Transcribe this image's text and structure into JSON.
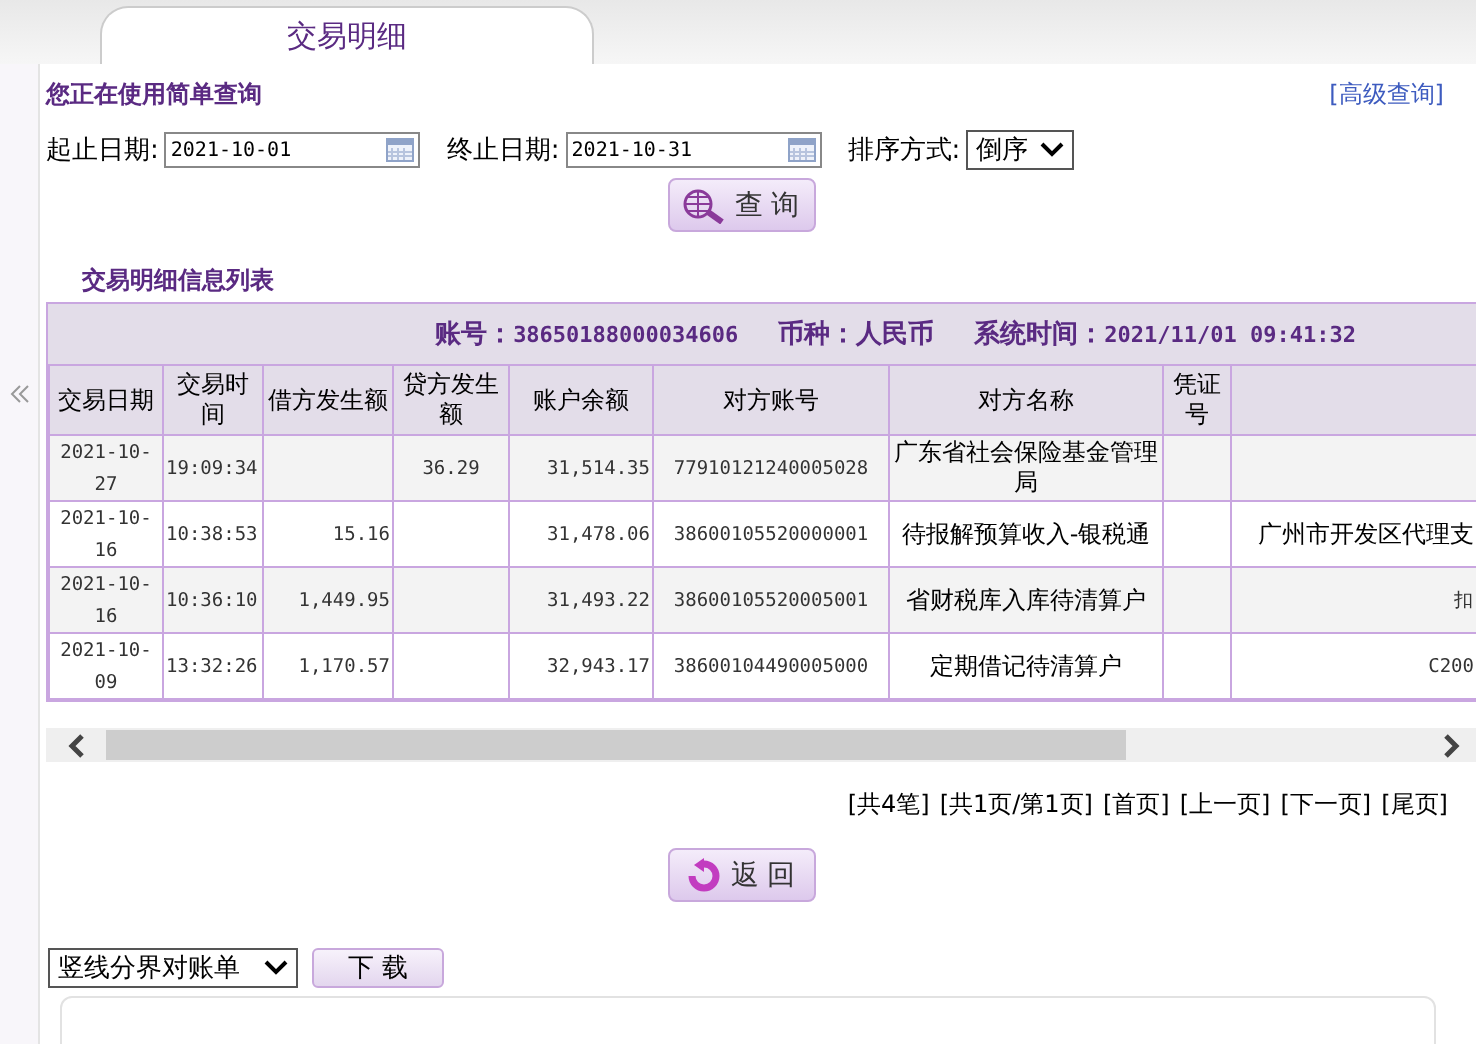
{
  "tab": {
    "label": "交易明细",
    "selected": true
  },
  "mode_label": "您正在使用简单查询",
  "advanced_link": "[高级查询]",
  "filters": {
    "start_label": "起止日期:",
    "start_date": "2021-10-01",
    "end_label": "终止日期:",
    "end_date": "2021-10-31",
    "sort_label": "排序方式:",
    "sort_value": "倒序"
  },
  "query_button": "查 询",
  "list_title": "交易明细信息列表",
  "info": [
    {
      "label": "账号：",
      "value": "38650188000034606"
    },
    {
      "label": "币种：",
      "value": "人民币"
    },
    {
      "label": "系统时间：",
      "value": "2021/11/01 09:41:32"
    }
  ],
  "columns": [
    "交易日期",
    "交易时间",
    "借方发生额",
    "贷方发生额",
    "账户余额",
    "对方账号",
    "对方名称",
    "凭证号"
  ],
  "rows": [
    {
      "cells": [
        "2021-10-27",
        "19:09:34",
        "",
        "36.29",
        "31,514.35",
        "77910121240005028",
        "广东省社会保险基金管理局",
        "",
        ""
      ]
    },
    {
      "cells": [
        "2021-10-16",
        "10:38:53",
        "15.16",
        "",
        "31,478.06",
        "38600105520000001",
        "待报解预算收入-银税通",
        "",
        "广州市开发区代理支"
      ]
    },
    {
      "cells": [
        "2021-10-16",
        "10:36:10",
        "1,449.95",
        "",
        "31,493.22",
        "38600105520005001",
        "省财税库入库待清算户",
        "",
        "扣"
      ]
    },
    {
      "cells": [
        "2021-10-09",
        "13:32:26",
        "1,170.57",
        "",
        "32,943.17",
        "38600104490005000",
        "定期借记待清算户",
        "",
        "C200"
      ]
    }
  ],
  "pagination": [
    "[共4笔]",
    "[共1页/第1页]",
    "[首页]",
    "[上一页]",
    "[下一页]",
    "[尾页]"
  ],
  "back_button": "返 回",
  "export_select": "竖线分界对账单",
  "download_button": "下 载"
}
